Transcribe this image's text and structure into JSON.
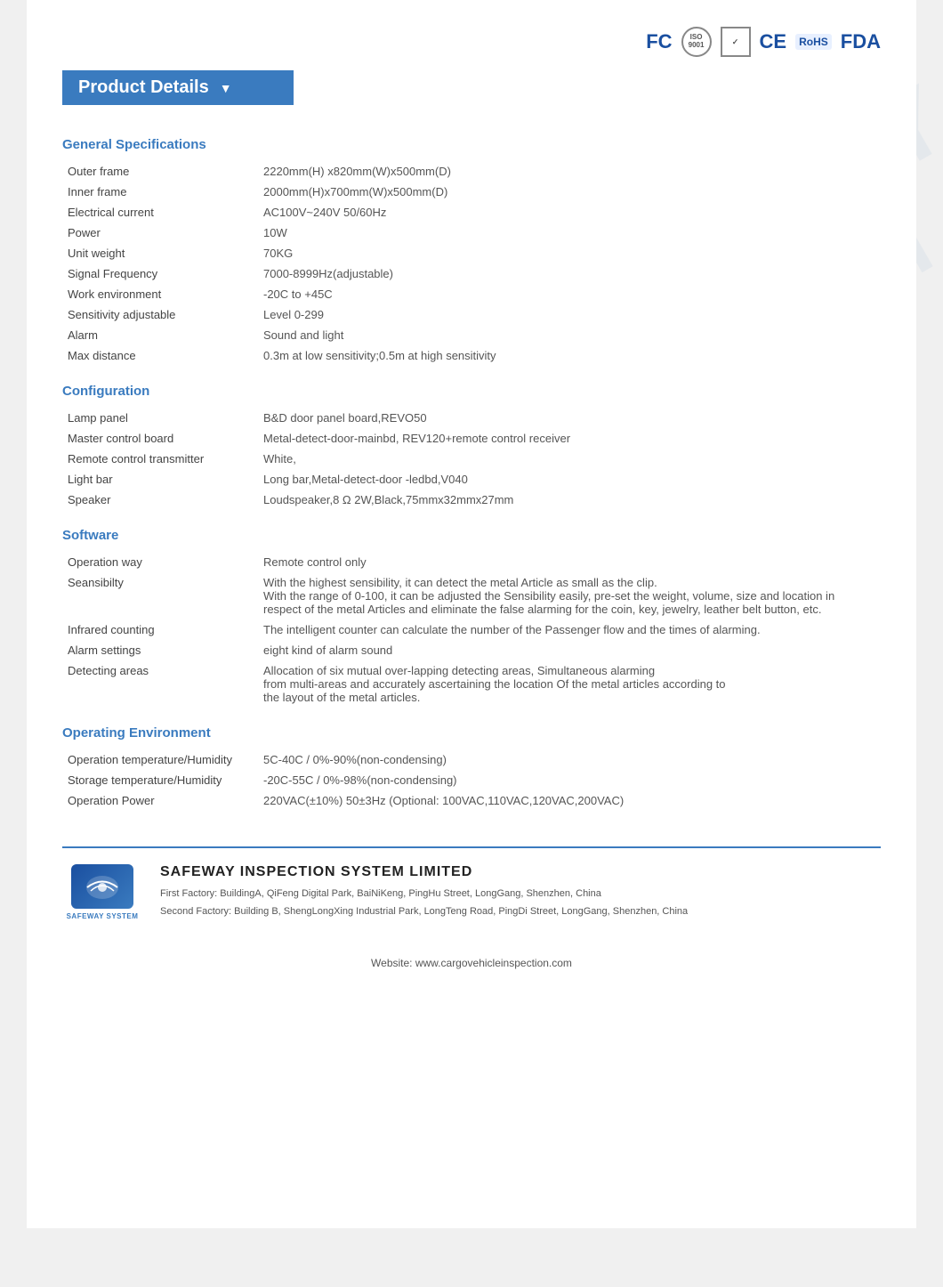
{
  "header": {
    "logos": [
      "FC",
      "ISO",
      "CERT",
      "CE",
      "RoHS",
      "FDA"
    ]
  },
  "banner": {
    "title": "Product Details",
    "arrow": "▼"
  },
  "sections": [
    {
      "id": "general",
      "title": "General Specifications",
      "rows": [
        {
          "label": "Outer frame",
          "value": "2220mm(H) x820mm(W)x500mm(D)"
        },
        {
          "label": "Inner frame",
          "value": "2000mm(H)x700mm(W)x500mm(D)"
        },
        {
          "label": "Electrical current",
          "value": "AC100V~240V   50/60Hz"
        },
        {
          "label": "Power",
          "value": "10W"
        },
        {
          "label": "Unit weight",
          "value": "70KG"
        },
        {
          "label": "Signal Frequency",
          "value": "7000-8999Hz(adjustable)"
        },
        {
          "label": "Work environment",
          "value": "-20C to +45C"
        },
        {
          "label": "Sensitivity adjustable",
          "value": "Level 0-299"
        },
        {
          "label": "Alarm",
          "value": "Sound and light"
        },
        {
          "label": "Max distance",
          "value": "0.3m at low sensitivity;0.5m at high sensitivity"
        }
      ]
    },
    {
      "id": "configuration",
      "title": "Configuration",
      "rows": [
        {
          "label": "Lamp panel",
          "value": "B&D door panel board,REVO50"
        },
        {
          "label": "Master control board",
          "value": "Metal-detect-door-mainbd, REV120+remote control receiver"
        },
        {
          "label": "Remote control transmitter",
          "value": "White,"
        },
        {
          "label": "Light bar",
          "value": "Long bar,Metal-detect-door -ledbd,V040"
        },
        {
          "label": "Speaker",
          "value": "Loudspeaker,8  Ω 2W,Black,75mmx32mmx27mm"
        }
      ]
    },
    {
      "id": "software",
      "title": "Software",
      "rows": [
        {
          "label": "Operation way",
          "value": "Remote control only"
        },
        {
          "label": "Seansibilty",
          "value": "With the highest sensibility, it can detect the metal Article as small as the clip.\nWith the range of 0-100, it can be adjusted the Sensibility easily, pre-set the weight, volume, size and location in respect of the metal Articles and eliminate the false alarming for the coin, key, jewelry, leather belt button, etc."
        },
        {
          "label": "Infrared counting",
          "value": "The intelligent counter can calculate the number of the Passenger flow and the times of alarming."
        },
        {
          "label": "Alarm settings",
          "value": "eight kind of alarm sound"
        },
        {
          "label": "Detecting areas",
          "value": "Allocation of six mutual over-lapping detecting areas, Simultaneous alarming\nfrom multi-areas and accurately ascertaining the location Of the metal articles according to\nthe layout of the metal articles."
        }
      ]
    },
    {
      "id": "operating",
      "title": "Operating Environment",
      "rows": [
        {
          "label": "Operation temperature/Humidity",
          "value": "5C-40C / 0%-90%(non-condensing)"
        },
        {
          "label": "Storage temperature/Humidity",
          "value": "-20C-55C / 0%-98%(non-condensing)"
        },
        {
          "label": "Operation Power",
          "value": "220VAC(±10%) 50±3Hz (Optional: 100VAC,110VAC,120VAC,200VAC)"
        }
      ]
    }
  ],
  "watermark": {
    "line1": "SAFEWAY",
    "line2": "SYSTEM"
  },
  "footer": {
    "company": "SAFEWAY INSPECTION SYSTEM LIMITED",
    "address1": "First Factory: BuildingA, QiFeng Digital Park, BaiNiKeng, PingHu Street, LongGang, Shenzhen, China",
    "address2": "Second Factory: Building B, ShengLongXing Industrial Park, LongTeng Road, PingDi Street, LongGang, Shenzhen, China",
    "logo_text": "SAFEWAY SYSTEM"
  },
  "website": {
    "label": "Website: www.cargovehicleinspection.com"
  }
}
